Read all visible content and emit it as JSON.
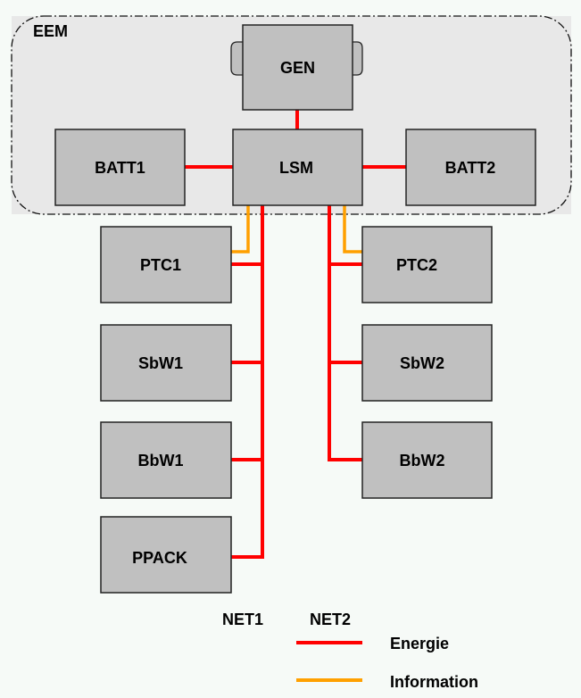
{
  "diagram": {
    "group": {
      "label": "EEM"
    },
    "nodes": {
      "gen": "GEN",
      "batt1": "BATT1",
      "lsm": "LSM",
      "batt2": "BATT2",
      "ptc1": "PTC1",
      "ptc2": "PTC2",
      "sbw1": "SbW1",
      "sbw2": "SbW2",
      "bbw1": "BbW1",
      "bbw2": "BbW2",
      "ppack": "PPACK"
    },
    "edges": [
      {
        "from": "GEN",
        "to": "LSM",
        "type": "Energie"
      },
      {
        "from": "BATT1",
        "to": "LSM",
        "type": "Energie"
      },
      {
        "from": "LSM",
        "to": "BATT2",
        "type": "Energie"
      },
      {
        "from": "LSM",
        "to": "PTC1",
        "type": "Energie",
        "net": "NET1"
      },
      {
        "from": "LSM",
        "to": "SbW1",
        "type": "Energie",
        "net": "NET1"
      },
      {
        "from": "LSM",
        "to": "BbW1",
        "type": "Energie",
        "net": "NET1"
      },
      {
        "from": "LSM",
        "to": "PPACK",
        "type": "Energie",
        "net": "NET1"
      },
      {
        "from": "LSM",
        "to": "PTC2",
        "type": "Energie",
        "net": "NET2"
      },
      {
        "from": "LSM",
        "to": "SbW2",
        "type": "Energie",
        "net": "NET2"
      },
      {
        "from": "LSM",
        "to": "BbW2",
        "type": "Energie",
        "net": "NET2"
      },
      {
        "from": "LSM",
        "to": "PTC1",
        "type": "Information"
      },
      {
        "from": "LSM",
        "to": "PTC2",
        "type": "Information"
      }
    ],
    "nets": {
      "net1": "NET1",
      "net2": "NET2"
    },
    "legend": {
      "energy": {
        "label": "Energie",
        "color": "#ff0000"
      },
      "information": {
        "label": "Information",
        "color": "#ffa000"
      }
    },
    "colors": {
      "background": "#f6faf7",
      "group_fill": "#e8e8e8",
      "box_fill": "#c0c0c0",
      "box_border": "#222222"
    }
  }
}
